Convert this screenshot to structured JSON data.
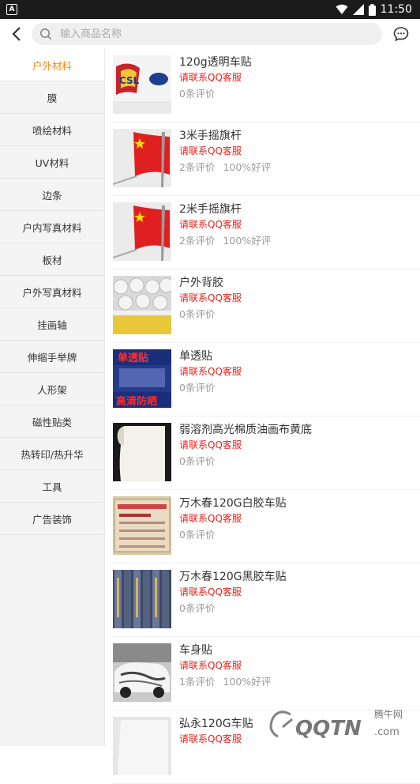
{
  "statusbar": {
    "app_letter": "A",
    "time": "11:50"
  },
  "search": {
    "placeholder": "输入商品名称"
  },
  "sidebar": {
    "items": [
      {
        "label": "户外材料",
        "active": true
      },
      {
        "label": "膜"
      },
      {
        "label": "喷绘材料"
      },
      {
        "label": "UV材料"
      },
      {
        "label": "边条"
      },
      {
        "label": "户内写真材料"
      },
      {
        "label": "板材"
      },
      {
        "label": "户外写真材料"
      },
      {
        "label": "挂画轴"
      },
      {
        "label": "伸缩手举牌"
      },
      {
        "label": "人形架"
      },
      {
        "label": "磁性贴类"
      },
      {
        "label": "热转印/热升华"
      },
      {
        "label": "工具"
      },
      {
        "label": "广告装饰"
      }
    ]
  },
  "products": [
    {
      "name": "120g透明车贴",
      "price": "请联系QQ客服",
      "reviews": "0条评价",
      "rate": "",
      "thumb_text": "CSL"
    },
    {
      "name": "3米手摇旗杆",
      "price": "请联系QQ客服",
      "reviews": "2条评价",
      "rate": "100%好评"
    },
    {
      "name": "2米手摇旗杆",
      "price": "请联系QQ客服",
      "reviews": "2条评价",
      "rate": "100%好评"
    },
    {
      "name": "户外背胶",
      "price": "请联系QQ客服",
      "reviews": "0条评价",
      "rate": ""
    },
    {
      "name": "单透贴",
      "price": "请联系QQ客服",
      "reviews": "0条评价",
      "rate": "",
      "thumb_text_top": "单透贴",
      "thumb_text_bottom": "高清防晒"
    },
    {
      "name": "弱溶剂高光棉质油画布黄底",
      "price": "请联系QQ客服",
      "reviews": "0条评价",
      "rate": ""
    },
    {
      "name": "万木春120G白胶车贴",
      "price": "请联系QQ客服",
      "reviews": "0条评价",
      "rate": ""
    },
    {
      "name": "万木春120G黑胶车贴",
      "price": "请联系QQ客服",
      "reviews": "0条评价",
      "rate": ""
    },
    {
      "name": "车身贴",
      "price": "请联系QQ客服",
      "reviews": "1条评价",
      "rate": "100%好评"
    },
    {
      "name": "弘永120G车贴",
      "price": "请联系QQ客服",
      "reviews": "",
      "rate": ""
    }
  ],
  "watermark": {
    "text_cn": "腾牛网",
    "text_en": "QQTN",
    "suffix": ".com"
  },
  "colors": {
    "accent": "#ef8a1a",
    "price": "#e8241c"
  }
}
